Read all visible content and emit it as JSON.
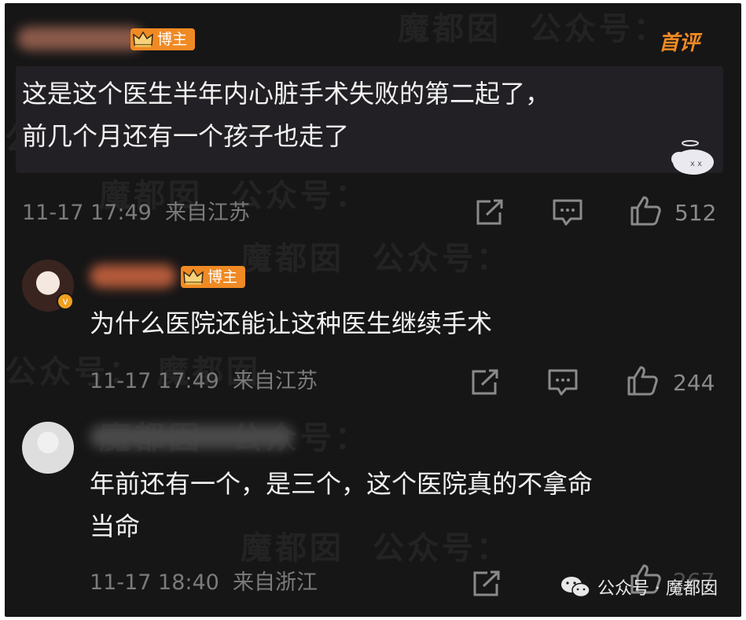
{
  "watermark_text": "魔都囡",
  "watermark_text_2": "公众号：",
  "top_badge": "首评",
  "comments": [
    {
      "badge": "博主",
      "text_lines": [
        "这是这个医生半年内心脏手术失败的第二起了，",
        "前几个月还有一个孩子也走了"
      ],
      "time": "11-17 17:49",
      "location": "来自江苏",
      "likes": "512"
    },
    {
      "badge": "博主",
      "text_lines": [
        "为什么医院还能让这种医生继续手术"
      ],
      "time": "11-17 17:49",
      "location": "来自江苏",
      "likes": "244"
    },
    {
      "badge": "",
      "text_lines": [
        "年前还有一个，是三个，这个医院真的不拿命",
        "当命"
      ],
      "time": "11-17 18:40",
      "location": "来自浙江",
      "likes": "267"
    }
  ],
  "wechat_label": "公众号 · 魔都囡",
  "colors": {
    "background": "#161616",
    "badge": "#f08a24",
    "text": "#f2f2f2",
    "meta": "#7b7b7b"
  },
  "icons": [
    "share-icon",
    "comment-icon",
    "like-icon",
    "crown-icon",
    "wechat-icon"
  ]
}
